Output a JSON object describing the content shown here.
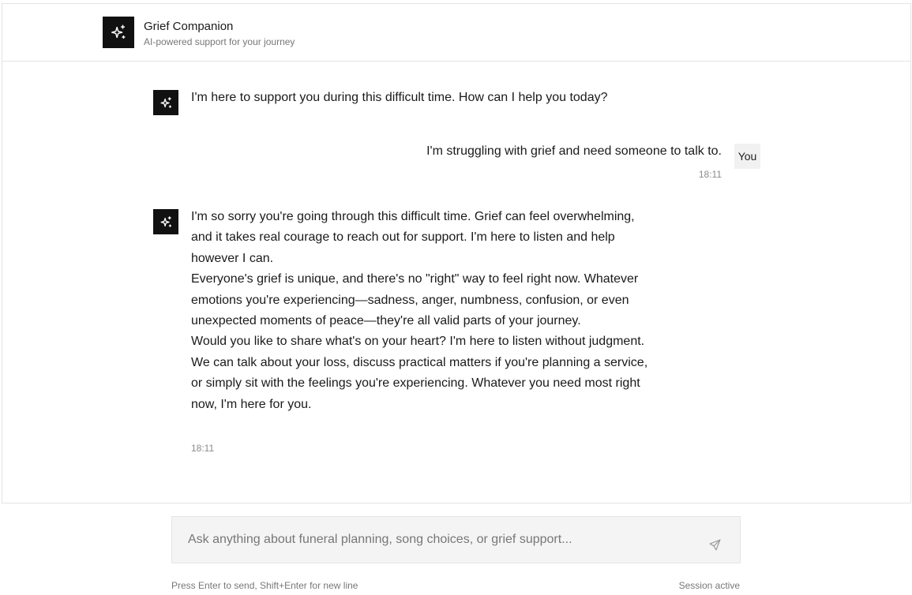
{
  "header": {
    "title": "Grief Companion",
    "subtitle": "AI-powered support for your journey",
    "logo_icon": "sparkles-icon"
  },
  "messages": [
    {
      "role": "assistant",
      "text": "I'm here to support you during this difficult time. How can I help you today?"
    },
    {
      "role": "user",
      "text": "I'm struggling with grief and need someone to talk to.",
      "time": "18:11",
      "badge": "You"
    },
    {
      "role": "assistant",
      "paragraphs": [
        "I'm so sorry you're going through this difficult time. Grief can feel overwhelming, and it takes real courage to reach out for support. I'm here to listen and help however I can.",
        "Everyone's grief is unique, and there's no \"right\" way to feel right now. Whatever emotions you're experiencing—sadness, anger, numbness, confusion, or even unexpected moments of peace—they're all valid parts of your journey.",
        "Would you like to share what's on your heart? I'm here to listen without judgment. We can talk about your loss, discuss practical matters if you're planning a service, or simply sit with the feelings you're experiencing. Whatever you need most right now, I'm here for you."
      ],
      "time": "18:11"
    }
  ],
  "composer": {
    "placeholder": "Ask anything about funeral planning, song choices, or grief support...",
    "value": "",
    "send_icon": "send-icon"
  },
  "footer": {
    "hint": "Press Enter to send, Shift+Enter for new line",
    "status": "Session active"
  }
}
